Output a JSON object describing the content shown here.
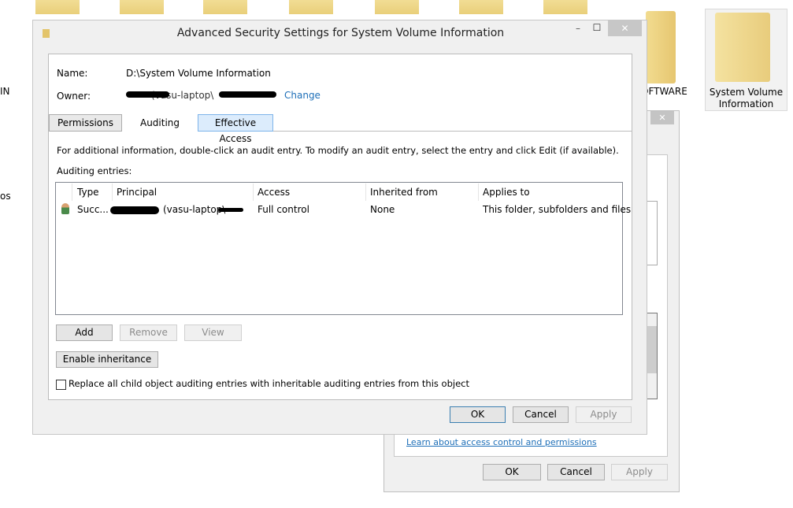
{
  "desktop": {
    "icons": [
      {
        "label": "IN"
      },
      {
        "label": "os"
      },
      {
        "label": "OFTWARE"
      },
      {
        "label": "System Volume Information"
      }
    ]
  },
  "back_dialog": {
    "link": "Learn about access control and permissions",
    "ok": "OK",
    "cancel": "Cancel",
    "apply": "Apply",
    "close": "✕"
  },
  "dialog": {
    "title": "Advanced Security Settings for System Volume Information",
    "name_label": "Name:",
    "name_value": "D:\\System Volume Information",
    "owner_label": "Owner:",
    "owner_value": "(vasu-laptop\\",
    "change_link": "Change",
    "tabs": [
      {
        "label": "Permissions"
      },
      {
        "label": "Auditing",
        "selected": true
      },
      {
        "label": "Effective Access"
      }
    ],
    "info": "For additional information, double-click an audit entry. To modify an audit entry, select the entry and click Edit (if available).",
    "entries_label": "Auditing entries:",
    "columns": [
      "Type",
      "Principal",
      "Access",
      "Inherited from",
      "Applies to"
    ],
    "rows": [
      {
        "type": "Succ...",
        "principal": "(vasu-laptop\\",
        "access": "Full control",
        "inherited": "None",
        "applies": "This folder, subfolders and files"
      }
    ],
    "buttons": {
      "add": "Add",
      "remove": "Remove",
      "view": "View",
      "enable_inheritance": "Enable inheritance"
    },
    "replace_checkbox": {
      "label": "Replace all child object auditing entries with inheritable auditing entries from this object",
      "checked": false
    },
    "ok": "OK",
    "cancel": "Cancel",
    "apply": "Apply",
    "minimize": "–",
    "maximize": "☐",
    "close": "✕"
  }
}
